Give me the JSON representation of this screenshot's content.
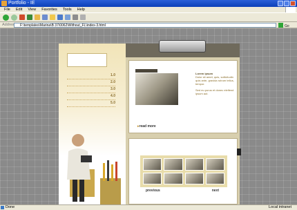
{
  "window": {
    "title": "Portfolio - IE"
  },
  "menu": {
    "items": [
      "File",
      "Edit",
      "View",
      "Favorites",
      "Tools",
      "Help"
    ]
  },
  "address": {
    "label": "Address",
    "url": "F:\\templates\\Marina\\B 37\\0062\\Without_FL\\index-3.html",
    "go_label": "Go"
  },
  "site": {
    "nav": [
      "1.0",
      "2.0",
      "3.0",
      "4.0",
      "5.0"
    ],
    "card1": {
      "heading": "Lorem ipsum",
      "body": "Dolor sit amet, quis, sollicitudin quis ante, gravida rutrum tellus, tempor.",
      "body2": "Sed eu purus et donec eleifend ipsum aut.",
      "more": "read more"
    },
    "card2": {
      "prev": "previous",
      "next": "next"
    }
  },
  "status": {
    "left": "Done",
    "right": "Local intranet"
  },
  "colors": {
    "accent": "#c9b57a",
    "dark": "#6f6a5c",
    "xp_blue": "#0b3fb8"
  }
}
